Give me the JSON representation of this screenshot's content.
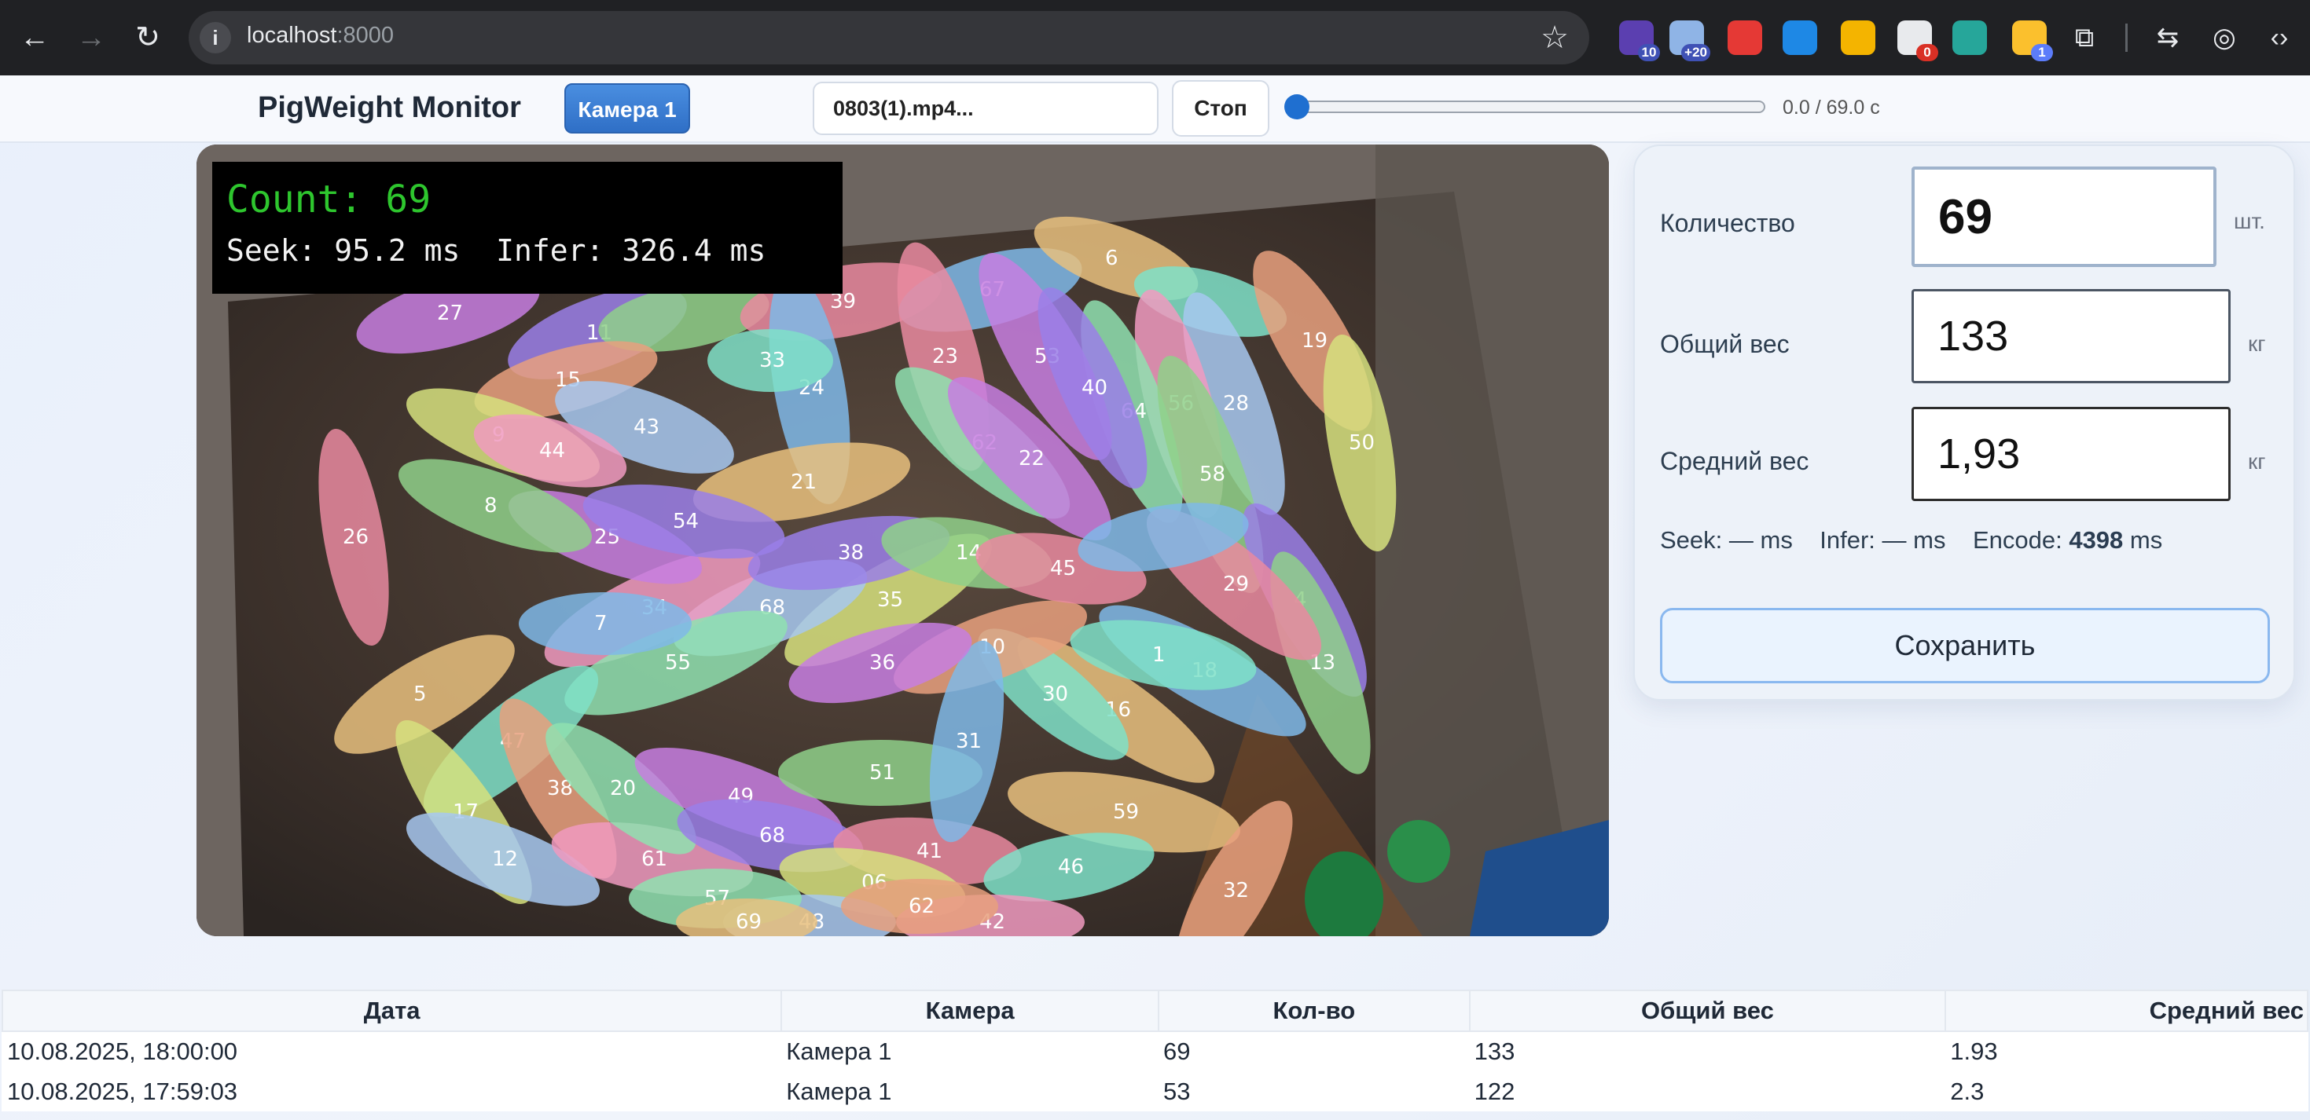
{
  "browser": {
    "url_host": "localhost",
    "url_port": ":8000",
    "extensions": [
      {
        "icon": "extension-purple-icon",
        "color": "#5b3fb0",
        "badge": "10",
        "badge_color": "#3f51b5"
      },
      {
        "icon": "weather-extension-icon",
        "color": "#8fb4e6",
        "badge": "+20",
        "badge_color": "#3f51b5"
      },
      {
        "icon": "adblock-hand-icon",
        "color": "#e53935",
        "badge": "",
        "badge_color": ""
      },
      {
        "icon": "voice-extension-icon",
        "color": "#1e88e5",
        "badge": "",
        "badge_color": ""
      },
      {
        "icon": "chromatic-extension-icon",
        "color": "#f4b400",
        "badge": "",
        "badge_color": ""
      },
      {
        "icon": "spy-extension-icon",
        "color": "#e8eaed",
        "badge": "0",
        "badge_color": "#d93025"
      },
      {
        "icon": "atom-extension-icon",
        "color": "#26a69a",
        "badge": "",
        "badge_color": ""
      },
      {
        "icon": "cookie-extension-icon",
        "color": "#fbc02d",
        "badge": "1",
        "badge_color": "#5c7cfa"
      }
    ]
  },
  "header": {
    "app_title": "PigWeight Monitor",
    "camera_button": "Камера 1",
    "file_name": "0803(1).mp4...",
    "stop_button": "Стоп",
    "progress": 0.0,
    "time_text": "0.0 / 69.0 с"
  },
  "video": {
    "overlay_count": "Count: 69",
    "overlay_timing": "Seek: 95.2 ms  Infer: 326.4 ms"
  },
  "panel": {
    "count_label": "Количество",
    "count_value": "69",
    "count_unit": "шт.",
    "total_label": "Общий вес",
    "total_value": "133",
    "total_unit": "кг",
    "avg_label": "Средний вес",
    "avg_value": "1,93",
    "avg_unit": "кг",
    "seek_text": "Seek: — ms",
    "infer_text": "Infer: — ms",
    "encode_label": "Encode:",
    "encode_value": "4398",
    "encode_unit": "ms",
    "save_button": "Сохранить"
  },
  "table": {
    "headers": [
      "Дата",
      "Камера",
      "Кол-во",
      "Общий вес",
      "Средний вес"
    ],
    "rows": [
      [
        "10.08.2025, 18:00:00",
        "Камера 1",
        "69",
        "133",
        "1.93"
      ],
      [
        "10.08.2025, 17:59:03",
        "Камера 1",
        "53",
        "122",
        "2.3"
      ]
    ]
  }
}
